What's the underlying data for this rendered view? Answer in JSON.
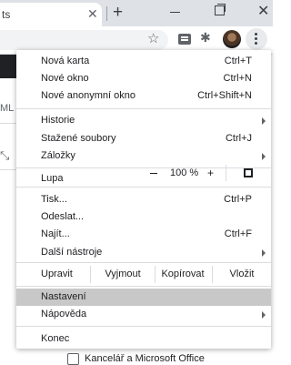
{
  "browser": {
    "tab_title": "ts",
    "tab_close_glyph": "✕",
    "new_tab_glyph": "+",
    "window_close_glyph": "✕",
    "star_glyph": "☆",
    "puzzle_glyph": "✱"
  },
  "page": {
    "sidebar_label": "ML",
    "arrows_glyph": "⤡",
    "checkbox_row_label": "Kancelář a Microsoft Office"
  },
  "menu": {
    "new_tab": {
      "label": "Nová karta",
      "shortcut": "Ctrl+T"
    },
    "new_window": {
      "label": "Nové okno",
      "shortcut": "Ctrl+N"
    },
    "incognito": {
      "label": "Nové anonymní okno",
      "shortcut": "Ctrl+Shift+N"
    },
    "history": {
      "label": "Historie"
    },
    "downloads": {
      "label": "Stažené soubory",
      "shortcut": "Ctrl+J"
    },
    "bookmarks": {
      "label": "Záložky"
    },
    "zoom": {
      "label": "Lupa",
      "value": "100 %",
      "plus": "+"
    },
    "print": {
      "label": "Tisk...",
      "shortcut": "Ctrl+P"
    },
    "cast": {
      "label": "Odeslat..."
    },
    "find": {
      "label": "Najít...",
      "shortcut": "Ctrl+F"
    },
    "more_tools": {
      "label": "Další nástroje"
    },
    "edit": {
      "label": "Upravit",
      "cut": "Vyjmout",
      "copy": "Kopírovat",
      "paste": "Vložit"
    },
    "settings": {
      "label": "Nastavení"
    },
    "help": {
      "label": "Nápověda"
    },
    "exit": {
      "label": "Konec"
    }
  },
  "colors": {
    "menu_highlight": "#c8c8c8",
    "tabstrip_bg": "#dee1e6",
    "separator": "#dadce0"
  }
}
